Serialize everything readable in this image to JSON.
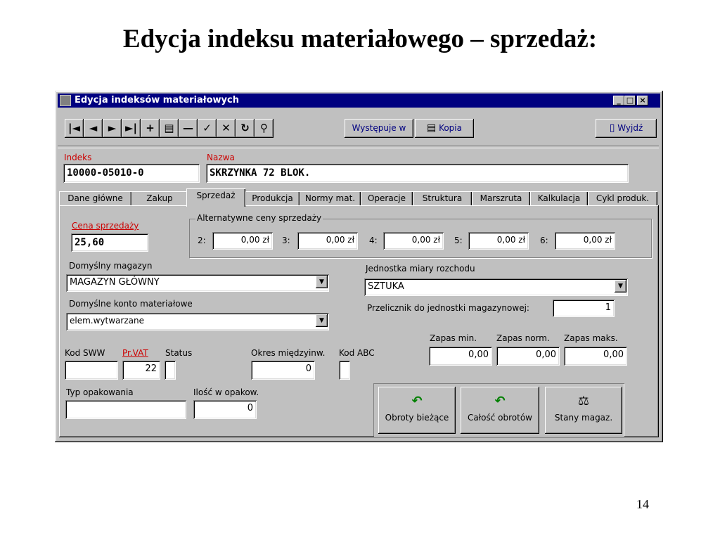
{
  "slide": {
    "title": "Edycja indeksu materiałowego – sprzedaż:",
    "page_number": "14"
  },
  "window": {
    "title": "Edycja indeksów materiałowych",
    "controls": [
      "_",
      "□",
      "×"
    ]
  },
  "toolbar": {
    "nav_buttons": [
      {
        "name": "first-record-icon",
        "glyph": "|◄"
      },
      {
        "name": "prev-record-icon",
        "glyph": "◄"
      },
      {
        "name": "next-record-icon",
        "glyph": "►"
      },
      {
        "name": "last-record-icon",
        "glyph": "►|"
      },
      {
        "name": "add-record-icon",
        "glyph": "+"
      },
      {
        "name": "edit-record-icon",
        "glyph": "▤"
      },
      {
        "name": "delete-record-icon",
        "glyph": "—"
      },
      {
        "name": "accept-icon",
        "glyph": "✓"
      },
      {
        "name": "cancel-icon",
        "glyph": "✕"
      },
      {
        "name": "refresh-icon",
        "glyph": "↻"
      },
      {
        "name": "find-icon",
        "glyph": "⚲"
      }
    ],
    "wystepuje_label": "Występuje w",
    "kopia_label": "Kopia",
    "wyjdz_label": "Wyjdź"
  },
  "header": {
    "indeks_label": "Indeks",
    "indeks_value": "10000-05010-0",
    "nazwa_label": "Nazwa",
    "nazwa_value": "SKRZYNKA 72 BLOK."
  },
  "tabs": [
    {
      "label": "Dane główne"
    },
    {
      "label": "Zakup"
    },
    {
      "label": "Sprzedaż",
      "active": true
    },
    {
      "label": "Produkcja"
    },
    {
      "label": "Normy mat."
    },
    {
      "label": "Operacje"
    },
    {
      "label": "Struktura"
    },
    {
      "label": "Marszruta"
    },
    {
      "label": "Kalkulacja"
    },
    {
      "label": "Cykl produk."
    }
  ],
  "sprzedaz": {
    "cena_label": "Cena sprzedaży",
    "cena_value": "25,60",
    "alt_group_title": "Alternatywne ceny sprzedaży",
    "alt_prices": [
      {
        "label": "2:",
        "value": "0,00 zł"
      },
      {
        "label": "3:",
        "value": "0,00 zł"
      },
      {
        "label": "4:",
        "value": "0,00 zł"
      },
      {
        "label": "5:",
        "value": "0,00 zł"
      },
      {
        "label": "6:",
        "value": "0,00 zł"
      }
    ],
    "magazyn_label": "Domyślny magazyn",
    "magazyn_value": "MAGAZYN GŁÓWNY",
    "konto_label": "Domyślne konto materiałowe",
    "konto_value": "elem.wytwarzane",
    "jednostka_label": "Jednostka miary rozchodu",
    "jednostka_value": "SZTUKA",
    "przelicznik_label": "Przelicznik do jednostki magazynowej:",
    "przelicznik_value": "1",
    "zapas_min_label": "Zapas min.",
    "zapas_min_value": "0,00",
    "zapas_norm_label": "Zapas norm.",
    "zapas_norm_value": "0,00",
    "zapas_maks_label": "Zapas maks.",
    "zapas_maks_value": "0,00",
    "kod_sww_label": "Kod SWW",
    "kod_sww_value": "",
    "pr_vat_label": "Pr.VAT",
    "pr_vat_value": "22",
    "status_label": "Status",
    "status_value": "",
    "okres_label": "Okres międzyinw.",
    "okres_value": "0",
    "kod_abc_label": "Kod ABC",
    "kod_abc_value": "",
    "typ_opak_label": "Typ opakowania",
    "typ_opak_value": "",
    "ilosc_opak_label": "Ilość w opakow.",
    "ilosc_opak_value": "0",
    "btn_obroty": "Obroty bieżące",
    "btn_calosc": "Całość obrotów",
    "btn_stany": "Stany magaz."
  },
  "colors": {
    "titlebar": "#000080",
    "window_face": "#c0c0c0",
    "required_label": "#cc0000"
  }
}
